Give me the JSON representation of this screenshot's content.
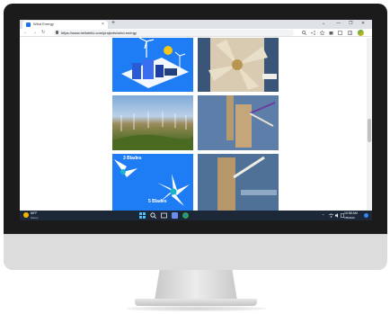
{
  "browser": {
    "tab_title": "Wind Energy",
    "tab_close": "×",
    "new_tab": "+",
    "url": "https://www.hellotello.com/projects/wind-energy",
    "window_controls": [
      "⌄",
      "—",
      "❐",
      "✕"
    ]
  },
  "toolbar": {
    "back": "←",
    "forward": "→",
    "reload": "↻"
  },
  "page": {
    "tiles": [
      {
        "label": "",
        "desc": "wind farm illustration"
      },
      {
        "label": "",
        "desc": "pinwheel on cork"
      },
      {
        "label": "",
        "desc": "hillside wind farm photo"
      },
      {
        "label": "",
        "desc": "cardboard turbine on tiles"
      },
      {
        "labels": [
          "3 Blades",
          "5 Blades"
        ],
        "desc": "blade diagram"
      },
      {
        "label": "",
        "desc": "cardboard turbine close-up"
      }
    ]
  },
  "taskbar": {
    "weather_temp": "86°F",
    "weather_desc": "Sunny",
    "time": "10:58 AM",
    "date": "7/8/2022"
  },
  "colors": {
    "accent_blue": "#1e7cf4",
    "taskbar": "#1c2738",
    "tab_strip": "#dee1e6"
  }
}
